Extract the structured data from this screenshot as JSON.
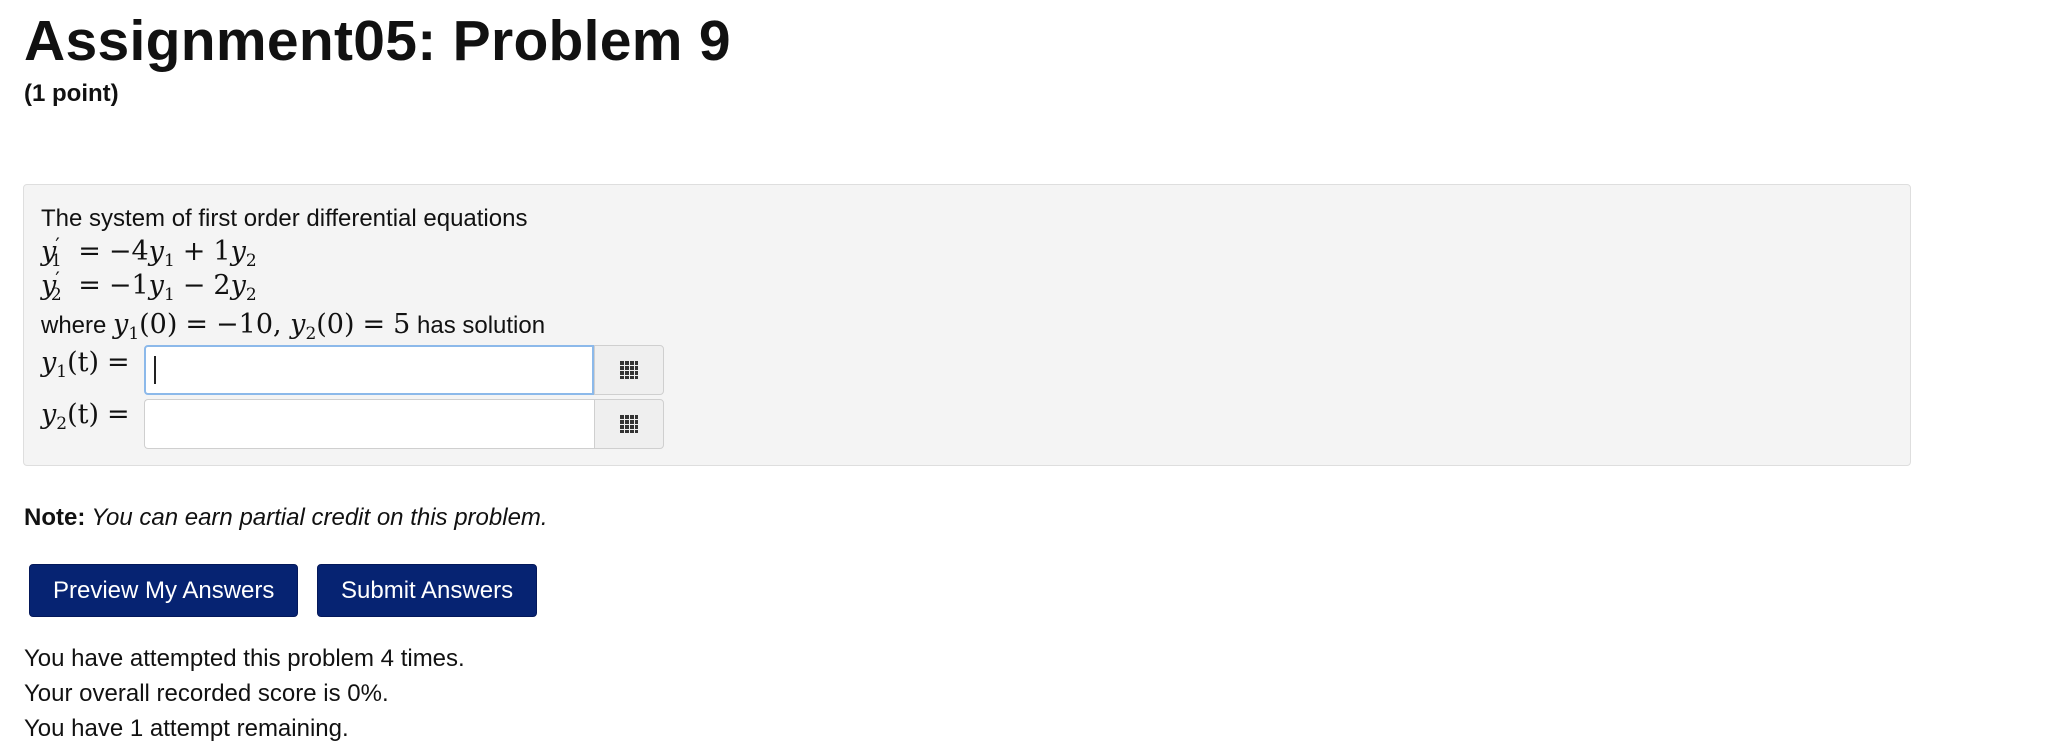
{
  "header": {
    "title": "Assignment05: Problem 9",
    "points": "(1 point)"
  },
  "problem": {
    "intro": "The system of first order differential equations",
    "eq1": {
      "lhs_var": "y",
      "lhs_sub": "1",
      "lhs_prime": "′",
      "eq_sign": "=",
      "c1": "−4",
      "v1": "y",
      "s1": "1",
      "op": "+",
      "c2": "1",
      "v2": "y",
      "s2": "2"
    },
    "eq2": {
      "lhs_var": "y",
      "lhs_sub": "2",
      "lhs_prime": "′",
      "eq_sign": "=",
      "c1": "−1",
      "v1": "y",
      "s1": "1",
      "op": "−",
      "c2": "2",
      "v2": "y",
      "s2": "2"
    },
    "initial": {
      "prefix": "where",
      "y1_var": "y",
      "y1_sub": "1",
      "y1_arg": "(0)",
      "y1_eq": "=",
      "y1_val": "−10,",
      "y2_var": "y",
      "y2_sub": "2",
      "y2_arg": "(0)",
      "y2_eq": "=",
      "y2_val": "5",
      "suffix": "has solution"
    },
    "answers": [
      {
        "var": "y",
        "sub": "1",
        "arg": "(t)",
        "eq": "=",
        "value": ""
      },
      {
        "var": "y",
        "sub": "2",
        "arg": "(t)",
        "eq": "=",
        "value": ""
      }
    ]
  },
  "note": {
    "label": "Note:",
    "text": "You can earn partial credit on this problem."
  },
  "buttons": {
    "preview": "Preview My Answers",
    "submit": "Submit Answers"
  },
  "status": {
    "attempts": "You have attempted this problem 4 times.",
    "score": "Your overall recorded score is 0%.",
    "remaining": "You have 1 attempt remaining."
  },
  "colors": {
    "button_bg": "#062372",
    "problem_bg": "#f4f4f4",
    "focus_border": "#8cb9ea"
  },
  "icons": {
    "equation_editor": "grid-icon"
  }
}
